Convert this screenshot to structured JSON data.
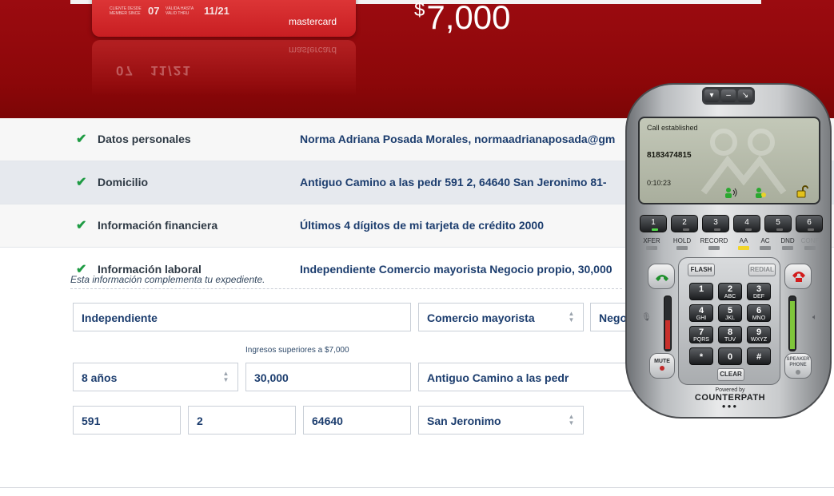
{
  "hero": {
    "card": {
      "member_since_label": "CLIENTE DESDE MEMBER SINCE",
      "member_since_value": "07",
      "valid_thru_label": "VÁLIDA HASTA VALID THRU",
      "valid_thru_value": "11/21",
      "brand": "mastercard"
    },
    "amount_currency": "$",
    "amount_value": "7,000"
  },
  "summary": {
    "rows": [
      {
        "label": "Datos personales",
        "value": "Norma Adriana Posada Morales, normaadrianaposada@gm"
      },
      {
        "label": "Domicilio",
        "value": "Antiguo Camino a las pedr 591 2, 64640 San Jeronimo 81-"
      },
      {
        "label": "Información financiera",
        "value": "Últimos 4 dígitos de mi tarjeta de crédito 2000"
      },
      {
        "label": "Información laboral",
        "value": "Independiente Comercio mayorista Negocio propio, 30,000"
      }
    ],
    "note": "Esta información complementa tu expediente."
  },
  "form": {
    "employment_type": "Independiente",
    "industry": "Comercio mayorista",
    "business_type": "Nego",
    "income_hint": "Ingresos superiores a $7,000",
    "years": "8 años",
    "income": "30,000",
    "street": "Antiguo Camino a las pedr",
    "ext_number": "591",
    "int_number": "2",
    "postal_code": "64640",
    "neighborhood": "San Jeronimo"
  },
  "softphone": {
    "status": "Call established",
    "number": "8183474815",
    "timer": "0:10:23",
    "lines": [
      "1",
      "2",
      "3",
      "4",
      "5",
      "6"
    ],
    "features": [
      "XFER",
      "HOLD",
      "RECORD",
      "AA",
      "AC",
      "DND",
      "CONF"
    ],
    "flash_label": "FLASH",
    "redial_label": "REDIAL",
    "clear_label": "CLEAR",
    "mute_label": "MUTE",
    "speaker_label": "SPEAKER PHONE",
    "powered_by": "Powered by",
    "brand": "COUNTERPATH",
    "keys": [
      {
        "digit": "1",
        "letters": ""
      },
      {
        "digit": "2",
        "letters": "ABC"
      },
      {
        "digit": "3",
        "letters": "DEF"
      },
      {
        "digit": "4",
        "letters": "GHI"
      },
      {
        "digit": "5",
        "letters": "JKL"
      },
      {
        "digit": "6",
        "letters": "MNO"
      },
      {
        "digit": "7",
        "letters": "PQRS"
      },
      {
        "digit": "8",
        "letters": "TUV"
      },
      {
        "digit": "9",
        "letters": "WXYZ"
      },
      {
        "digit": "*",
        "letters": ""
      },
      {
        "digit": "0",
        "letters": ""
      },
      {
        "digit": "#",
        "letters": ""
      }
    ]
  },
  "colors": {
    "hero_red": "#8c0709",
    "check_green": "#1e9b43",
    "value_blue": "#1c3d6e"
  }
}
